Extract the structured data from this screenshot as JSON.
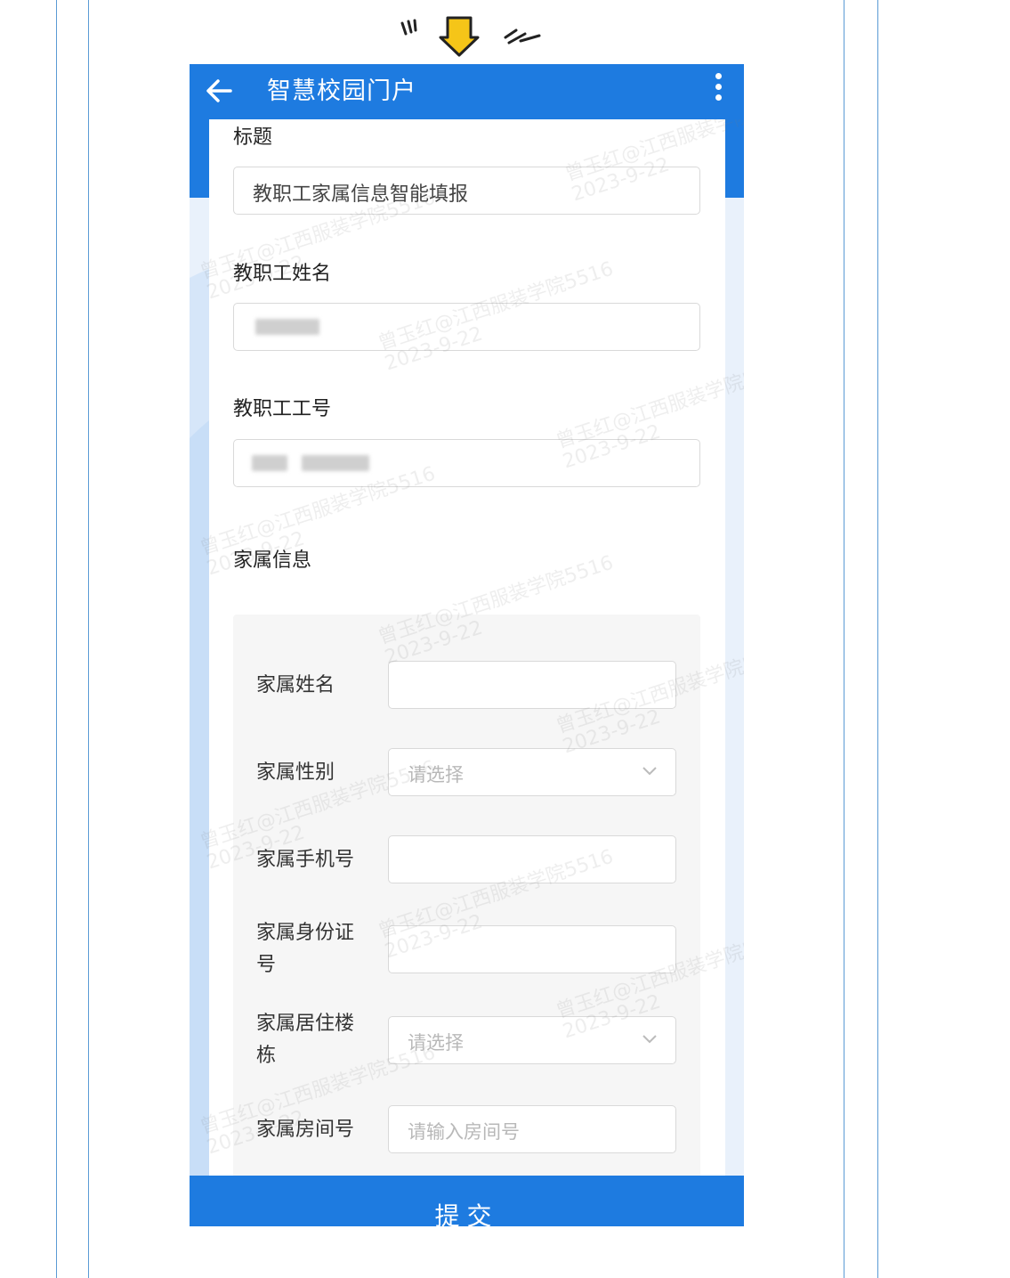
{
  "header": {
    "title": "智慧校园门户",
    "back_icon": "arrow-left-icon",
    "menu_icon": "more-vertical-icon"
  },
  "form": {
    "title_label": "标题",
    "title_value": "教职工家属信息智能填报",
    "name_label": "教职工姓名",
    "name_value": "",
    "id_label": "教职工工号",
    "id_value": "",
    "family_section_label": "家属信息",
    "family": {
      "name_label": "家属姓名",
      "gender_label": "家属性别",
      "gender_placeholder": "请选择",
      "phone_label": "家属手机号",
      "idcard_label": "家属身份证号",
      "building_label": "家属居住楼栋",
      "building_placeholder": "请选择",
      "room_label": "家属房间号",
      "room_placeholder": "请输入房间号"
    }
  },
  "submit_label": "提交",
  "watermark": {
    "line1": "曾玉红@江西服装学院5516",
    "line2": "2023-9-22"
  },
  "colors": {
    "primary": "#1e7be0",
    "frame_line": "#5b9bd5",
    "doodle_arrow": "#f5c518"
  }
}
